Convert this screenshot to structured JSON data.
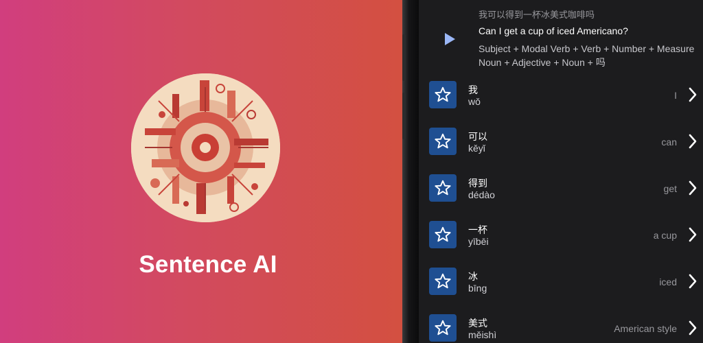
{
  "promo": {
    "app_name": "Sentence AI"
  },
  "sentence": {
    "chinese": "我可以得到一杯冰美式咖啡吗",
    "english": "Can I get a cup of iced Americano?",
    "grammar": "Subject + Modal Verb + Verb + Number + Measure Noun + Adjective + Noun + 吗",
    "play_icon": "play-icon"
  },
  "words": [
    {
      "hanzi": "我",
      "pinyin": "wǒ",
      "meaning": "I"
    },
    {
      "hanzi": "可以",
      "pinyin": "kěyǐ",
      "meaning": "can"
    },
    {
      "hanzi": "得到",
      "pinyin": "dédào",
      "meaning": "get"
    },
    {
      "hanzi": "一杯",
      "pinyin": "yībēi",
      "meaning": "a cup"
    },
    {
      "hanzi": "冰",
      "pinyin": "bīng",
      "meaning": "iced"
    },
    {
      "hanzi": "美式",
      "pinyin": "měishì",
      "meaning": "American style"
    }
  ],
  "colors": {
    "gradient_left": "#d13e7e",
    "gradient_right": "#d3503f",
    "screen_background": "#1c1c1e",
    "star_button": "#1f4f92",
    "accent_play": "#9bb7f6"
  }
}
